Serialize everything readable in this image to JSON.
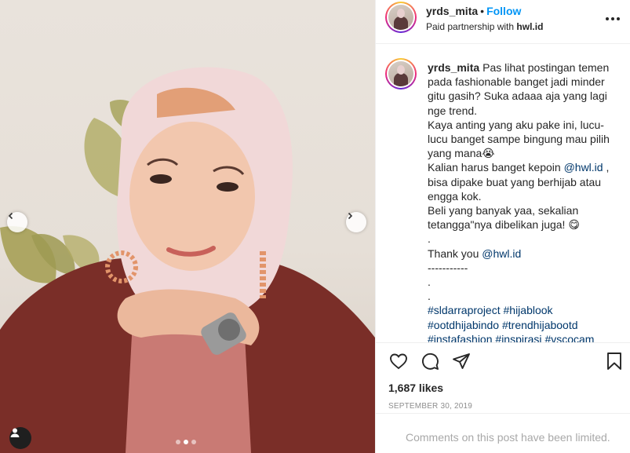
{
  "post": {
    "username": "yrds_mita",
    "separator": "•",
    "follow_label": "Follow",
    "partnership_prefix": "Paid partnership with ",
    "partner": "hwl.id"
  },
  "caption": {
    "username": "yrds_mita",
    "line1": "Pas lihat postingan temen pada fashionable banget jadi minder gitu gasih? Suka adaaa aja yang lagi nge trend.",
    "line2": "Kaya anting yang aku pake ini, lucu-lucu banget sampe bingung mau pilih yang mana😭",
    "line3_before": "Kalian harus banget kepoin ",
    "line3_mention": "@hwl.id",
    "line3_after": " , bisa dipake buat yang berhijab atau engga kok.",
    "line4": "Beli yang banyak yaa, sekalian tetangga\"nya dibelikan juga! 😋",
    "dot1": ".",
    "line5_before": "Thank you ",
    "line5_mention": "@hwl.id",
    "dashes": "-----------",
    "dot2": ".",
    "dot3": ".",
    "hashtags_line1": [
      "#sldarraproject",
      "#hijablook"
    ],
    "hashtags_line2": [
      "#ootdhijabindo",
      "#trendhijabootd"
    ],
    "hashtags_line3": [
      "#instafashion",
      "#inspirasi",
      "#vscocam"
    ]
  },
  "actions": {
    "icons": [
      "heart-icon",
      "comment-icon",
      "share-icon",
      "bookmark-icon"
    ],
    "likes": "1,687 likes",
    "date": "SEPTEMBER 30, 2019",
    "comments_limited": "Comments on this post have been limited."
  },
  "carousel": {
    "total": 3,
    "active_index": 1
  },
  "colors": {
    "follow": "#0095f6",
    "link": "#00376b",
    "muted": "#8e8e8e",
    "border": "#efefef"
  }
}
